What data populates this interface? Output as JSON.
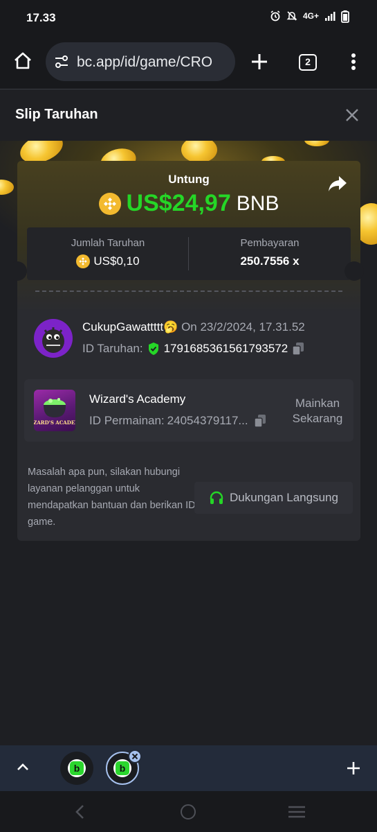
{
  "status": {
    "time": "17.33",
    "network": "4G+"
  },
  "browser": {
    "url": "bc.app/id/game/CRO",
    "tab_count": "2"
  },
  "sheet": {
    "title": "Slip Taruhan"
  },
  "bet_slip": {
    "profit_label": "Untung",
    "profit_amount": "US$24,97",
    "profit_currency": "BNB",
    "wager_label": "Jumlah Taruhan",
    "wager_value": "US$0,10",
    "payout_label": "Pembayaran",
    "payout_value": "250.7556 x",
    "colors": {
      "profit": "#25d627",
      "coin": "#f3ba2f"
    }
  },
  "user": {
    "username": "CukupGawattttt🥱",
    "date": "On 23/2/2024, 17.31.52",
    "bet_id_label": "ID Taruhan:",
    "bet_id": "1791685361561793572"
  },
  "game": {
    "title": "Wizard's Academy",
    "thumb_text": "WIZARD'S ACADEMY",
    "game_id_label": "ID Permainan:",
    "game_id": "24054379117...",
    "play_now": "Mainkan Sekarang"
  },
  "support": {
    "help_text": "Masalah apa pun, silakan hubungi layanan pelanggan untuk mendapatkan bantuan dan berikan ID game.",
    "button_label": "Dukungan Langsung"
  },
  "tab_strip": {
    "logo_letter": "b"
  }
}
